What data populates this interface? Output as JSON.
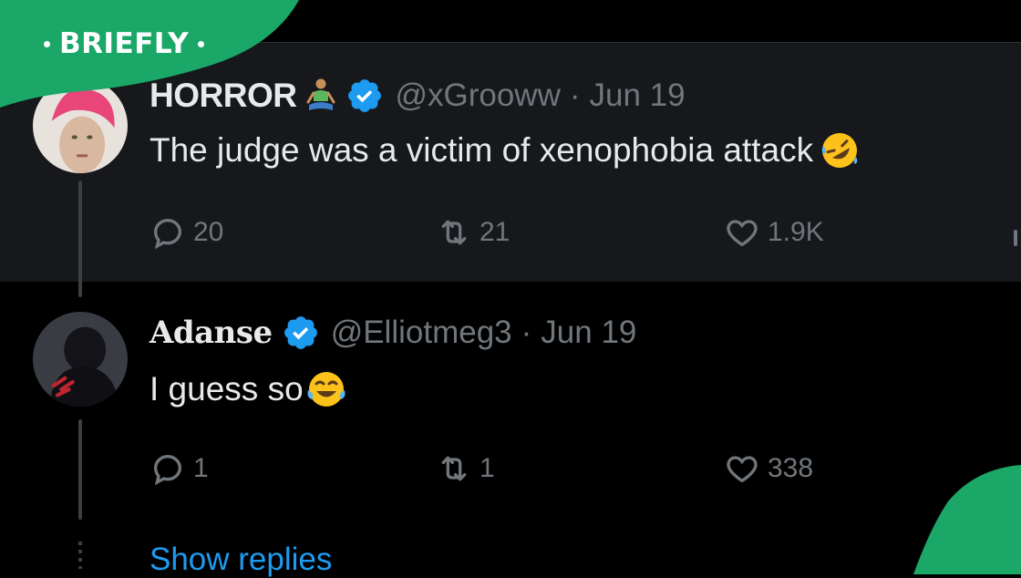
{
  "brand": {
    "label": "BRIEFLY",
    "color": "#1aa767"
  },
  "tweets": [
    {
      "display_name": "HORROR",
      "name_icon": "person-in-lotus-position-emoji",
      "verified_icon": "verified-badge-icon",
      "handle": "@xGrooww",
      "separator": "·",
      "date": "Jun 19",
      "text": "The judge was a victim of xenophobia attack",
      "text_emoji": "rolling-on-the-floor-laughing-emoji",
      "stats": {
        "replies": "20",
        "retweets": "21",
        "likes": "1.9K"
      }
    },
    {
      "display_name": "Adanse",
      "verified_icon": "verified-badge-icon",
      "handle": "@Elliotmeg3",
      "separator": "·",
      "date": "Jun 19",
      "text": "I guess so",
      "text_emoji": "face-with-tears-of-joy-emoji",
      "stats": {
        "replies": "1",
        "retweets": "1",
        "likes": "338"
      }
    }
  ],
  "show_replies": "Show replies",
  "colors": {
    "background": "#000000",
    "highlight_row": "#16181c",
    "text_primary": "#e7e9ea",
    "text_secondary": "#71767b",
    "link": "#1d9bf0",
    "verified": "#1d9bf0"
  }
}
